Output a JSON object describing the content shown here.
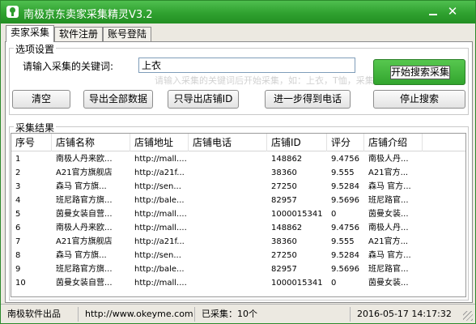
{
  "window": {
    "title": "南极京东卖家采集精灵V3.2"
  },
  "tabs": [
    {
      "label": "卖家采集",
      "active": true
    },
    {
      "label": "软件注册",
      "active": false
    },
    {
      "label": "账号登陆",
      "active": false
    }
  ],
  "options": {
    "group_label": "选项设置",
    "keyword_label": "请输入采集的关键词:",
    "keyword_value": "上衣",
    "hint_text": "请输入采集的关键词后开始采集，如：上衣，T恤，采集"
  },
  "buttons": {
    "start": "开始搜索采集",
    "clear": "清空",
    "export_all": "导出全部数据",
    "export_id": "只导出店铺ID",
    "get_phone": "进一步得到电话",
    "stop": "停止搜索"
  },
  "results": {
    "group_label": "采集结果",
    "columns": [
      "序号",
      "店铺名称",
      "店铺地址",
      "店铺电话",
      "店铺ID",
      "评分",
      "店铺介绍"
    ],
    "rows": [
      [
        "1",
        "南极人丹来欧...",
        "http://mall....",
        "",
        "148862",
        "9.4756",
        "南极人丹..."
      ],
      [
        "2",
        "A21官方旗舰店",
        "http://a21f...",
        "",
        "38360",
        "9.555",
        "A21官方..."
      ],
      [
        "3",
        "森马 官方旗...",
        "http://sen...",
        "",
        "27250",
        "9.5284",
        "森马 官方..."
      ],
      [
        "4",
        "班尼路官方旗...",
        "http://bale...",
        "",
        "82957",
        "9.5696",
        "班尼路官..."
      ],
      [
        "5",
        "茵曼女装自营...",
        "http://mall....",
        "",
        "1000015341",
        "0",
        "茵曼女装..."
      ],
      [
        "6",
        "南极人丹来欧...",
        "http://mall....",
        "",
        "148862",
        "9.4756",
        "南极人丹..."
      ],
      [
        "7",
        "A21官方旗舰店",
        "http://a21f...",
        "",
        "38360",
        "9.555",
        "A21官方..."
      ],
      [
        "8",
        "森马 官方旗...",
        "http://sen...",
        "",
        "27250",
        "9.5284",
        "森马 官方..."
      ],
      [
        "9",
        "班尼路官方旗...",
        "http://bale...",
        "",
        "82957",
        "9.5696",
        "班尼路官..."
      ],
      [
        "10",
        "茵曼女装自营...",
        "http://mall....",
        "",
        "1000015341",
        "0",
        "茵曼女装..."
      ]
    ]
  },
  "status": {
    "vendor": "南极软件出品",
    "url": "http://www.okeyme.com",
    "count": "已采集：10个",
    "datetime": "2016-05-17 14:17:32"
  }
}
